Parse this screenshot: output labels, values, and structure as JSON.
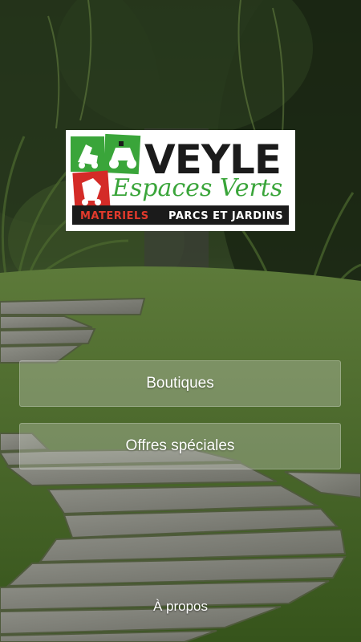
{
  "logo": {
    "brand": "VEYLE",
    "subtitle": "Espaces Verts",
    "band_left": "MATERIELS",
    "band_right": "PARCS ET JARDINS",
    "colors": {
      "green": "#3aa53a",
      "red": "#d42b27",
      "dark": "#1b1b1b",
      "band_right": "#ffffff",
      "band_left": "#e23a2c"
    }
  },
  "menu": {
    "boutiques": "Boutiques",
    "offres": "Offres spéciales",
    "about": "À propos"
  }
}
